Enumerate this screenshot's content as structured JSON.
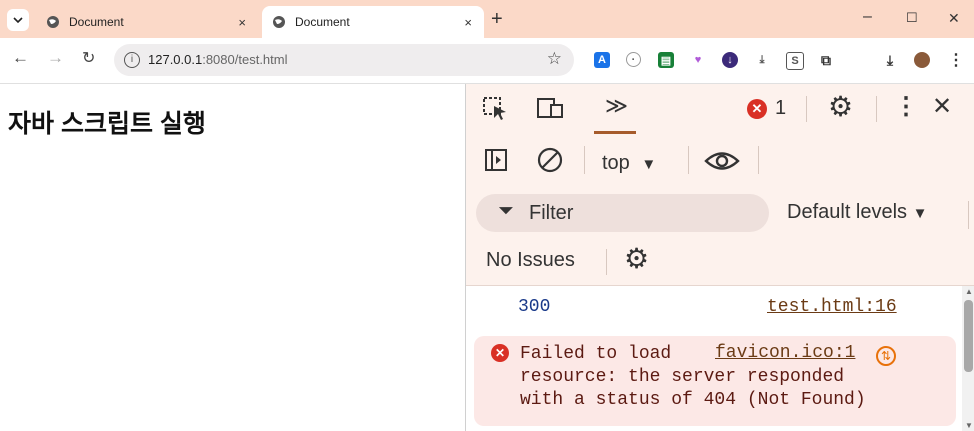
{
  "browser": {
    "tabs": [
      {
        "title": "Document",
        "active": false
      },
      {
        "title": "Document",
        "active": true
      }
    ],
    "tab_close": "×",
    "new_tab": "+",
    "url_host": "127.0.0.1",
    "url_rest": ":8080/test.html",
    "window_controls": {
      "minimize": "–",
      "maximize": "☐",
      "close": "✕"
    },
    "colors": {
      "tabstrip": "#fbd9c8",
      "omnibox": "#efedee"
    }
  },
  "page": {
    "heading": "자바 스크립트 실행"
  },
  "devtools": {
    "error_count": "1",
    "context": "top",
    "filter_placeholder": "Filter",
    "levels": "Default levels",
    "issues": "No Issues",
    "console": {
      "log": {
        "value": "300",
        "source": "test.html:16"
      },
      "error": {
        "message": "Failed to load\nresource: the server responded\nwith a status of 404 (Not Found)",
        "link": "favicon.ico:1"
      }
    },
    "colors": {
      "panel": "#fdf2ed",
      "error": "#d93025",
      "error_bg": "#fce8e6",
      "accent": "#a65b2b"
    }
  }
}
